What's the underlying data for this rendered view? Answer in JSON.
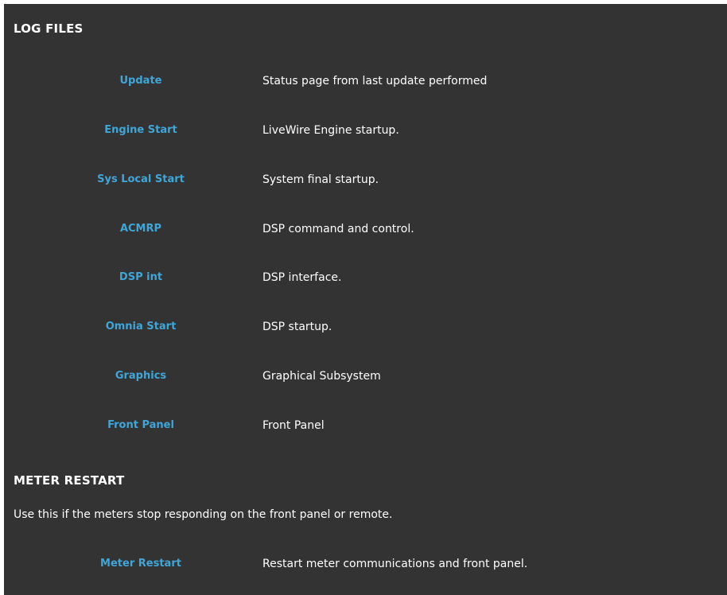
{
  "log_files": {
    "title": "LOG FILES",
    "items": [
      {
        "link": "Update",
        "description": "Status page from last update performed"
      },
      {
        "link": "Engine Start",
        "description": "LiveWire Engine startup."
      },
      {
        "link": "Sys Local Start",
        "description": "System final startup."
      },
      {
        "link": "ACMRP",
        "description": "DSP command and control."
      },
      {
        "link": "DSP int",
        "description": "DSP interface."
      },
      {
        "link": "Omnia Start",
        "description": "DSP startup."
      },
      {
        "link": "Graphics",
        "description": "Graphical Subsystem"
      },
      {
        "link": "Front Panel",
        "description": "Front Panel"
      }
    ]
  },
  "meter_restart": {
    "title": "METER RESTART",
    "note": "Use this if the meters stop responding on the front panel or remote.",
    "link": "Meter Restart",
    "description": "Restart meter communications and front panel."
  },
  "colors": {
    "background": "#333333",
    "link": "#3fa6d9",
    "text": "#ffffff"
  }
}
